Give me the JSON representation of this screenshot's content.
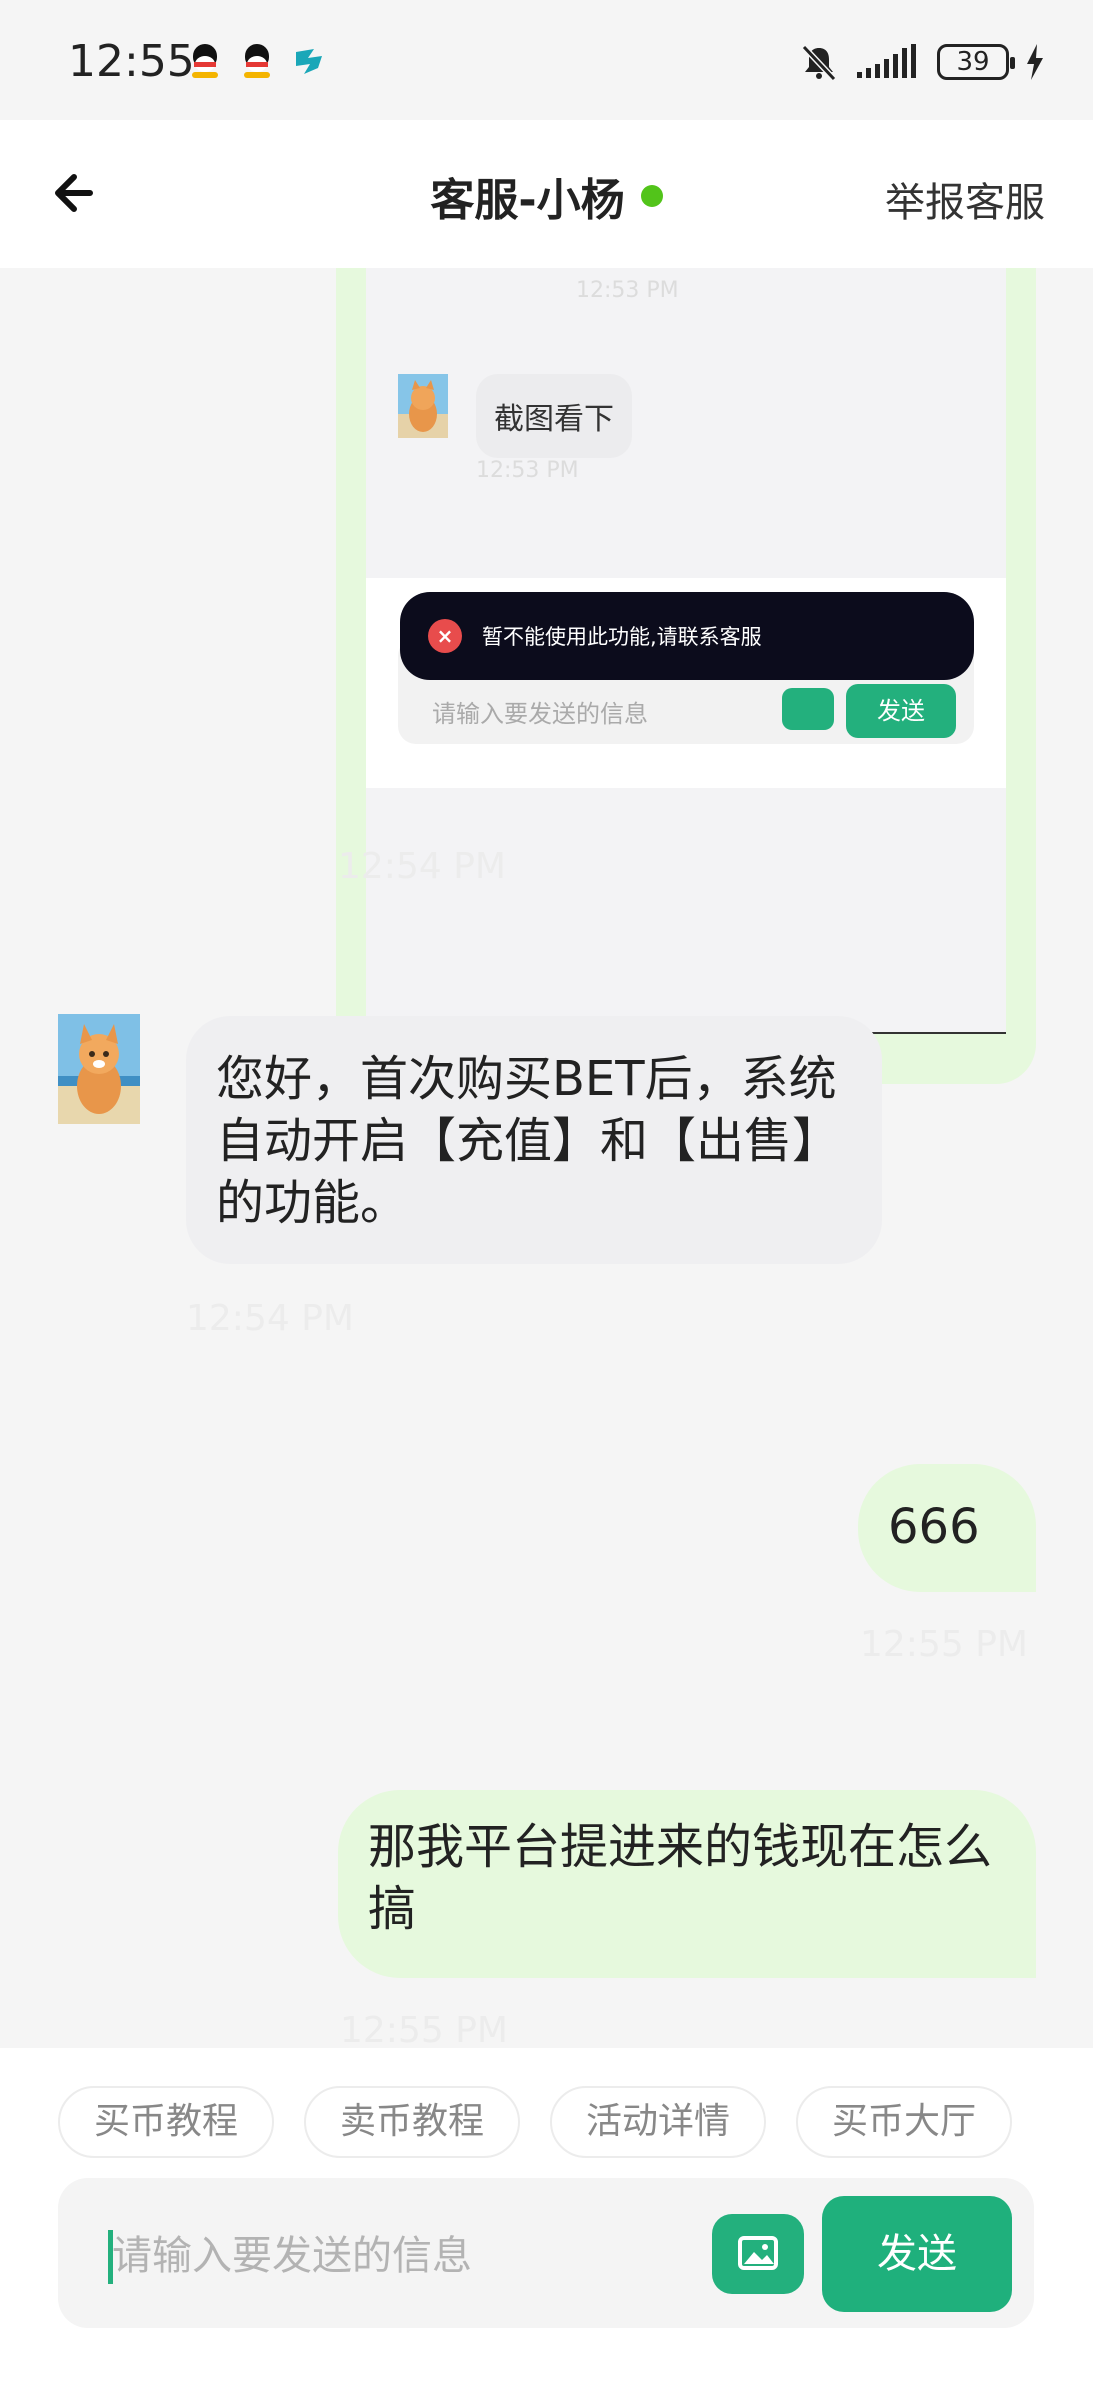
{
  "status_bar": {
    "time": "12:55",
    "battery": "39"
  },
  "header": {
    "title": "客服-小杨",
    "report": "举报客服"
  },
  "chat": {
    "screenshot": {
      "timestamp_top": "12:53 PM",
      "message": "截图看下",
      "message_time": "12:53 PM",
      "toast": "暂不能使用此功能,请联系客服",
      "input_placeholder": "请输入要发送的信息",
      "send_label": "发送",
      "timestamp": "12:54 PM"
    },
    "messages": [
      {
        "side": "left",
        "text": "您好，首次购买BET后，系统自动开启【充值】和【出售】的功能。",
        "time": "12:54 PM"
      },
      {
        "side": "right",
        "text": "666",
        "time": "12:55 PM"
      },
      {
        "side": "right",
        "text": "那我平台提进来的钱现在怎么搞",
        "time": "12:55 PM"
      }
    ]
  },
  "quick_replies": [
    "买币教程",
    "卖币教程",
    "活动详情",
    "买币大厅"
  ],
  "composer": {
    "placeholder": "请输入要发送的信息",
    "send_label": "发送"
  },
  "colors": {
    "accent": "#1fb07c",
    "online": "#52c41a",
    "bubble_self": "#e6f9dd",
    "bubble_other": "#efeff1"
  },
  "icons": [
    "qq-penguin-icon",
    "app-logo-icon",
    "bell-muted-icon",
    "signal-icon",
    "battery-icon",
    "charging-icon",
    "back-arrow-icon",
    "image-icon",
    "error-icon"
  ]
}
